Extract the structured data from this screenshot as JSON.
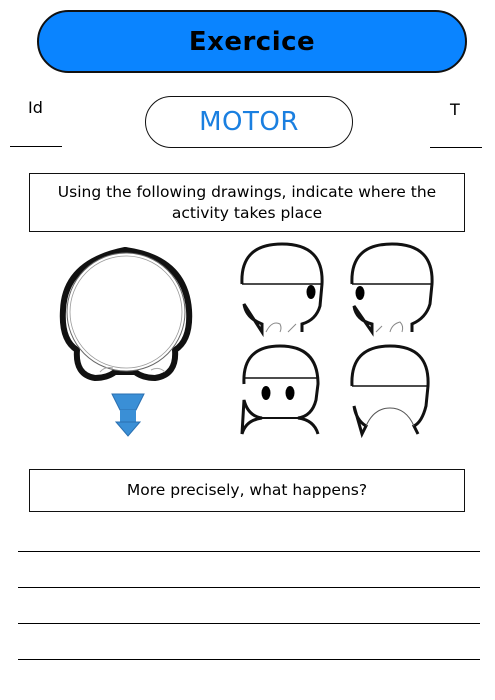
{
  "header": {
    "title": "Exercice"
  },
  "fields": {
    "left_label": "Id",
    "right_label": "T"
  },
  "topic": {
    "label": "MOTOR"
  },
  "question1": {
    "text": "Using the following drawings, indicate where the activity takes place"
  },
  "question2": {
    "text": "More precisely, what happens?"
  },
  "answer_lines": 4,
  "head_views": [
    "top",
    "right-profile",
    "left-profile",
    "front",
    "back"
  ],
  "icons": [
    "arrow-down-icon"
  ],
  "colors": {
    "accent": "#0a84ff",
    "blue_text": "#1a7fe0",
    "arrow": "#3a8fd6"
  }
}
